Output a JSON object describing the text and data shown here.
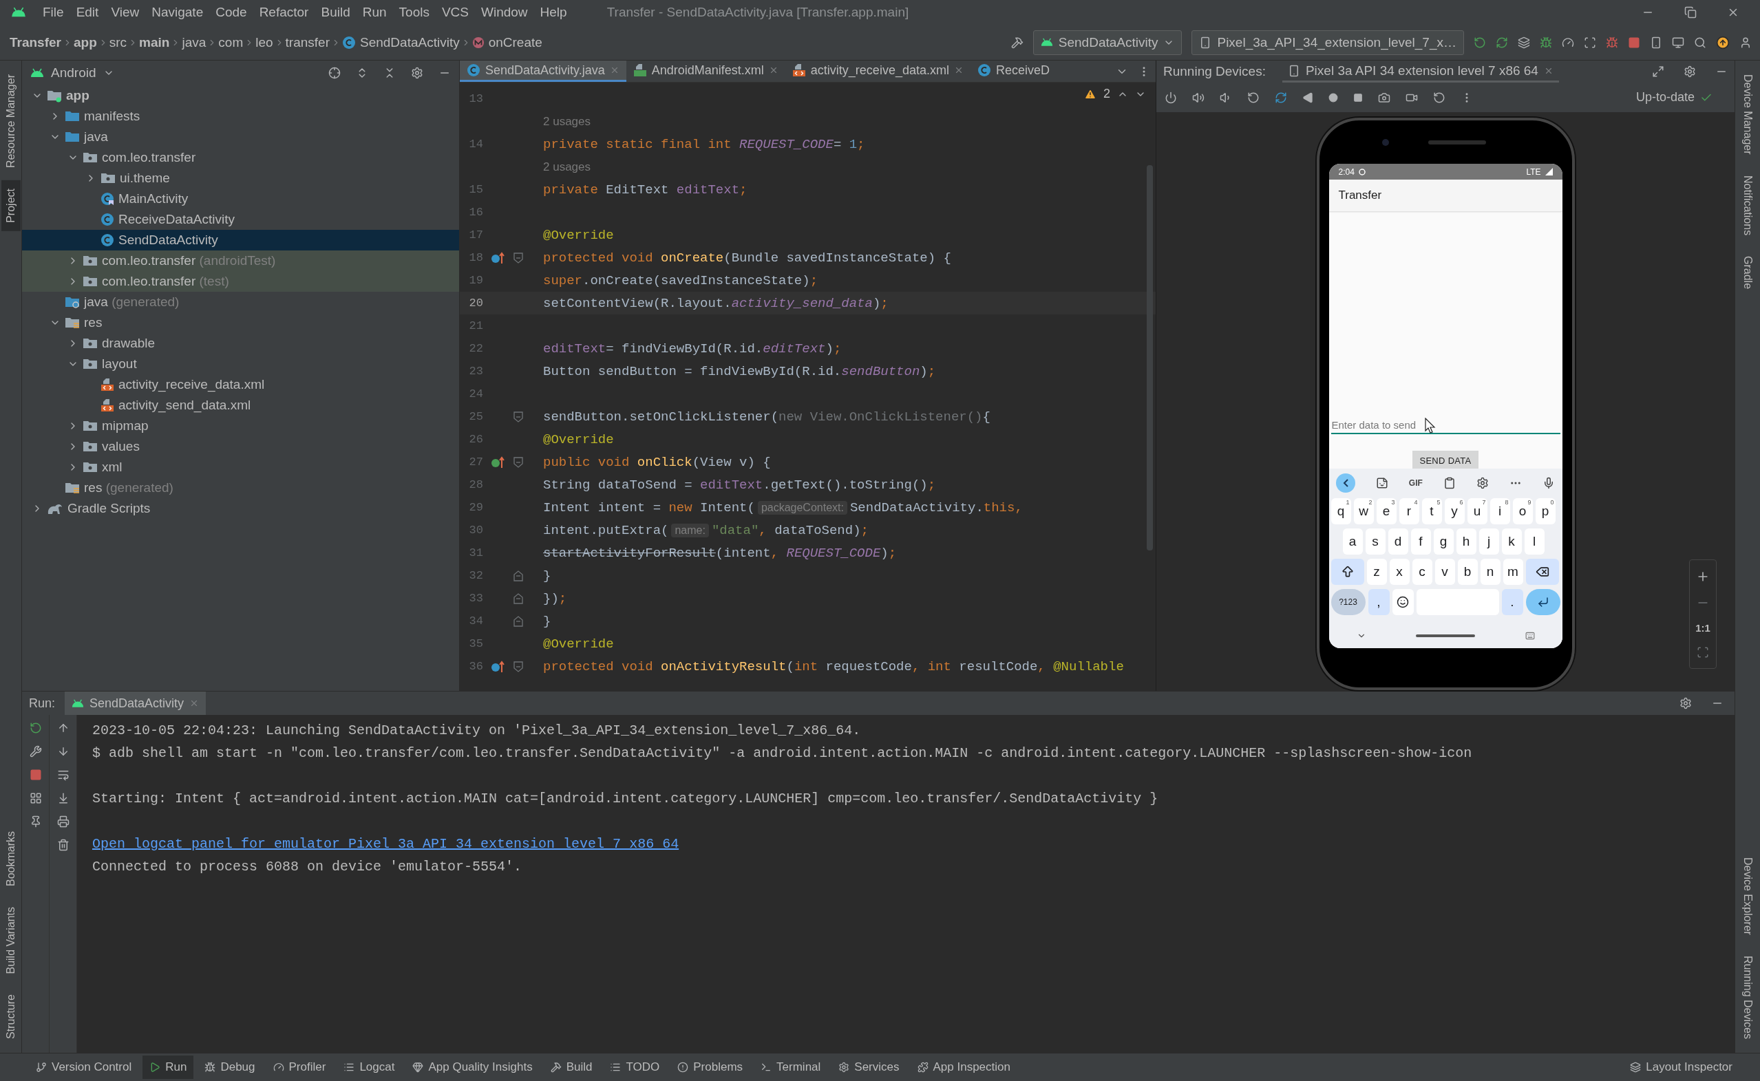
{
  "window": {
    "title": "Transfer - SendDataActivity.java [Transfer.app.main]"
  },
  "menu": [
    "File",
    "Edit",
    "View",
    "Navigate",
    "Code",
    "Refactor",
    "Build",
    "Run",
    "Tools",
    "VCS",
    "Window",
    "Help"
  ],
  "breadcrumbs": [
    {
      "label": "Transfer",
      "kind": "plain",
      "bold": true
    },
    {
      "label": "app",
      "kind": "plain",
      "bold": true
    },
    {
      "label": "src",
      "kind": "plain",
      "bold": false
    },
    {
      "label": "main",
      "kind": "plain",
      "bold": true
    },
    {
      "label": "java",
      "kind": "plain",
      "bold": false
    },
    {
      "label": "com",
      "kind": "plain",
      "bold": false
    },
    {
      "label": "leo",
      "kind": "plain",
      "bold": false
    },
    {
      "label": "transfer",
      "kind": "plain",
      "bold": false
    },
    {
      "label": "SendDataActivity",
      "kind": "class",
      "bold": false
    },
    {
      "label": "onCreate",
      "kind": "method",
      "bold": false
    }
  ],
  "toolbar": {
    "run_config": "SendDataActivity",
    "device": "Pixel_3a_API_34_extension_level_7_x…"
  },
  "left_strip": {
    "top": [
      {
        "label": "Resource Manager",
        "selected": false
      },
      {
        "label": "Project",
        "selected": true
      }
    ],
    "bottom": [
      {
        "label": "Bookmarks",
        "selected": false
      },
      {
        "label": "Build Variants",
        "selected": false
      },
      {
        "label": "Structure",
        "selected": false
      }
    ]
  },
  "right_strip": {
    "top": [
      {
        "label": "Device Manager",
        "selected": false
      },
      {
        "label": "Notifications",
        "selected": false
      },
      {
        "label": "Gradle",
        "selected": false
      }
    ],
    "bottom": [
      {
        "label": "Device Explorer",
        "selected": false
      },
      {
        "label": "Running Devices",
        "selected": false
      }
    ]
  },
  "project": {
    "view": "Android",
    "tree": [
      {
        "label": "app",
        "kind": "module",
        "expanded": true,
        "selected": false,
        "highlighted": false,
        "children": [
          {
            "label": "manifests",
            "kind": "source-folder",
            "expanded": false,
            "selected": false,
            "highlighted": false
          },
          {
            "label": "java",
            "kind": "source-folder",
            "expanded": true,
            "selected": false,
            "highlighted": false,
            "children": [
              {
                "label": "com.leo.transfer",
                "kind": "package",
                "expanded": true,
                "selected": false,
                "highlighted": false,
                "children": [
                  {
                    "label": "ui.theme",
                    "kind": "package",
                    "expanded": false,
                    "selected": false,
                    "highlighted": false
                  },
                  {
                    "label": "MainActivity",
                    "kind": "activity-class",
                    "selected": false,
                    "highlighted": false
                  },
                  {
                    "label": "ReceiveDataActivity",
                    "kind": "class",
                    "selected": false,
                    "highlighted": false
                  },
                  {
                    "label": "SendDataActivity",
                    "kind": "class",
                    "selected": true,
                    "highlighted": false
                  }
                ]
              },
              {
                "label": "com.leo.transfer",
                "suffix": "(androidTest)",
                "kind": "package",
                "expanded": false,
                "selected": false,
                "highlighted": true
              },
              {
                "label": "com.leo.transfer",
                "suffix": "(test)",
                "kind": "package",
                "expanded": false,
                "selected": false,
                "highlighted": true
              }
            ]
          },
          {
            "label": "java",
            "suffix": "(generated)",
            "kind": "generated-folder",
            "selected": false,
            "highlighted": false
          },
          {
            "label": "res",
            "kind": "res-folder",
            "expanded": true,
            "selected": false,
            "highlighted": false,
            "children": [
              {
                "label": "drawable",
                "kind": "package",
                "expanded": false,
                "selected": false,
                "highlighted": false
              },
              {
                "label": "layout",
                "kind": "package",
                "expanded": true,
                "selected": false,
                "highlighted": false,
                "children": [
                  {
                    "label": "activity_receive_data.xml",
                    "kind": "layout-file",
                    "selected": false,
                    "highlighted": false
                  },
                  {
                    "label": "activity_send_data.xml",
                    "kind": "layout-file",
                    "selected": false,
                    "highlighted": false
                  }
                ]
              },
              {
                "label": "mipmap",
                "kind": "package",
                "expanded": false,
                "selected": false,
                "highlighted": false
              },
              {
                "label": "values",
                "kind": "package",
                "expanded": false,
                "selected": false,
                "highlighted": false
              },
              {
                "label": "xml",
                "kind": "package",
                "expanded": false,
                "selected": false,
                "highlighted": false
              }
            ]
          },
          {
            "label": "res",
            "suffix": "(generated)",
            "kind": "res-folder",
            "selected": false,
            "highlighted": false
          }
        ]
      },
      {
        "label": "Gradle Scripts",
        "kind": "gradle",
        "expanded": false,
        "selected": false,
        "highlighted": false
      }
    ]
  },
  "editor": {
    "tabs": [
      {
        "label": "SendDataActivity.java",
        "kind": "class",
        "selected": true,
        "closable": true
      },
      {
        "label": "AndroidManifest.xml",
        "kind": "manifest",
        "selected": false,
        "closable": true
      },
      {
        "label": "activity_receive_data.xml",
        "kind": "layout-file",
        "selected": false,
        "closable": true
      },
      {
        "label": "ReceiveD",
        "kind": "class",
        "selected": false,
        "closable": false
      }
    ],
    "warnings": "2",
    "lines": [
      {
        "kind": "code",
        "number": "13",
        "current": false,
        "overrides": false,
        "implements": false,
        "fold_start": false,
        "fold_end": false
      },
      {
        "kind": "usage",
        "text": "2 usages"
      },
      {
        "kind": "code",
        "number": "14",
        "current": false,
        "overrides": false,
        "implements": false,
        "fold_start": false,
        "fold_end": false,
        "tokens": [
          {
            "kind": "keyword",
            "text": "private static final int "
          },
          {
            "kind": "static",
            "text": "REQUEST_CODE"
          },
          {
            "kind": "plain",
            "text": " = "
          },
          {
            "kind": "number",
            "text": "1"
          },
          {
            "kind": "keyword",
            "text": ";"
          }
        ]
      },
      {
        "kind": "usage",
        "text": "2 usages"
      },
      {
        "kind": "code",
        "number": "15",
        "current": false,
        "overrides": false,
        "implements": false,
        "fold_start": false,
        "fold_end": false,
        "tokens": [
          {
            "kind": "keyword",
            "text": "private "
          },
          {
            "kind": "plain",
            "text": "EditText "
          },
          {
            "kind": "field",
            "text": "editText"
          },
          {
            "kind": "keyword",
            "text": ";"
          }
        ]
      },
      {
        "kind": "code",
        "number": "16",
        "current": false,
        "overrides": false,
        "implements": false,
        "fold_start": false,
        "fold_end": false
      },
      {
        "kind": "code",
        "number": "17",
        "current": false,
        "overrides": false,
        "implements": false,
        "fold_start": false,
        "fold_end": false,
        "tokens": [
          {
            "kind": "annotation",
            "text": "@Override"
          }
        ]
      },
      {
        "kind": "code",
        "number": "18",
        "current": false,
        "overrides": true,
        "implements": false,
        "fold_start": true,
        "fold_end": false,
        "tokens": [
          {
            "kind": "keyword",
            "text": "protected void "
          },
          {
            "kind": "declaration",
            "text": "onCreate"
          },
          {
            "kind": "plain",
            "text": "(Bundle savedInstanceState) {"
          }
        ]
      },
      {
        "kind": "code",
        "number": "19",
        "current": false,
        "overrides": false,
        "implements": false,
        "fold_start": false,
        "fold_end": false,
        "tokens": [
          {
            "kind": "keyword",
            "text": "    super"
          },
          {
            "kind": "plain",
            "text": ".onCreate(savedInstanceState)"
          },
          {
            "kind": "keyword",
            "text": ";"
          }
        ]
      },
      {
        "kind": "code",
        "number": "20",
        "current": true,
        "overrides": false,
        "implements": false,
        "fold_start": false,
        "fold_end": false,
        "tokens": [
          {
            "kind": "plain",
            "text": "    setContentView(R.layout."
          },
          {
            "kind": "static",
            "text": "activity_send_data"
          },
          {
            "kind": "plain",
            "text": ")"
          },
          {
            "kind": "keyword",
            "text": ";"
          }
        ]
      },
      {
        "kind": "code",
        "number": "21",
        "current": false,
        "overrides": false,
        "implements": false,
        "fold_start": false,
        "fold_end": false
      },
      {
        "kind": "code",
        "number": "22",
        "current": false,
        "overrides": false,
        "implements": false,
        "fold_start": false,
        "fold_end": false,
        "tokens": [
          {
            "kind": "field",
            "text": "    editText"
          },
          {
            "kind": "plain",
            "text": " = findViewById(R.id."
          },
          {
            "kind": "static",
            "text": "editText"
          },
          {
            "kind": "plain",
            "text": ")"
          },
          {
            "kind": "keyword",
            "text": ";"
          }
        ]
      },
      {
        "kind": "code",
        "number": "23",
        "current": false,
        "overrides": false,
        "implements": false,
        "fold_start": false,
        "fold_end": false,
        "tokens": [
          {
            "kind": "plain",
            "text": "    Button sendButton = findViewById(R.id."
          },
          {
            "kind": "static",
            "text": "sendButton"
          },
          {
            "kind": "plain",
            "text": ")"
          },
          {
            "kind": "keyword",
            "text": ";"
          }
        ]
      },
      {
        "kind": "code",
        "number": "24",
        "current": false,
        "overrides": false,
        "implements": false,
        "fold_start": false,
        "fold_end": false
      },
      {
        "kind": "code",
        "number": "25",
        "current": false,
        "overrides": false,
        "implements": false,
        "fold_start": true,
        "fold_end": false,
        "tokens": [
          {
            "kind": "plain",
            "text": "    sendButton.setOnClickListener("
          },
          {
            "kind": "dim",
            "text": "new View.OnClickListener()"
          },
          {
            "kind": "plain",
            "text": " {"
          }
        ]
      },
      {
        "kind": "code",
        "number": "26",
        "current": false,
        "overrides": false,
        "implements": false,
        "fold_start": false,
        "fold_end": false,
        "tokens": [
          {
            "kind": "annotation",
            "text": "        @Override"
          }
        ]
      },
      {
        "kind": "code",
        "number": "27",
        "current": false,
        "overrides": false,
        "implements": true,
        "fold_start": true,
        "fold_end": false,
        "tokens": [
          {
            "kind": "keyword",
            "text": "        public void "
          },
          {
            "kind": "declaration",
            "text": "onClick"
          },
          {
            "kind": "plain",
            "text": "(View v) {"
          }
        ]
      },
      {
        "kind": "code",
        "number": "28",
        "current": false,
        "overrides": false,
        "implements": false,
        "fold_start": false,
        "fold_end": false,
        "tokens": [
          {
            "kind": "plain",
            "text": "            String dataToSend = "
          },
          {
            "kind": "field",
            "text": "editText"
          },
          {
            "kind": "plain",
            "text": ".getText().toString()"
          },
          {
            "kind": "keyword",
            "text": ";"
          }
        ]
      },
      {
        "kind": "code",
        "number": "29",
        "current": false,
        "overrides": false,
        "implements": false,
        "fold_start": false,
        "fold_end": false,
        "tokens": [
          {
            "kind": "plain",
            "text": "            Intent intent = "
          },
          {
            "kind": "keyword",
            "text": "new "
          },
          {
            "kind": "plain",
            "text": "Intent("
          },
          {
            "kind": "hint",
            "text": "packageContext:"
          },
          {
            "kind": "plain",
            "text": "SendDataActivity."
          },
          {
            "kind": "keyword",
            "text": "this,"
          }
        ]
      },
      {
        "kind": "code",
        "number": "30",
        "current": false,
        "overrides": false,
        "implements": false,
        "fold_start": false,
        "fold_end": false,
        "tokens": [
          {
            "kind": "plain",
            "text": "            intent.putExtra("
          },
          {
            "kind": "hint",
            "text": "name:"
          },
          {
            "kind": "string",
            "text": "\"data\""
          },
          {
            "kind": "keyword",
            "text": ", "
          },
          {
            "kind": "plain",
            "text": "dataToSend)"
          },
          {
            "kind": "keyword",
            "text": ";"
          }
        ]
      },
      {
        "kind": "code",
        "number": "31",
        "current": false,
        "overrides": false,
        "implements": false,
        "fold_start": false,
        "fold_end": false,
        "tokens": [
          {
            "kind": "deprecated",
            "text": "            startActivityForResult"
          },
          {
            "kind": "plain",
            "text": "(intent"
          },
          {
            "kind": "keyword",
            "text": ", "
          },
          {
            "kind": "static",
            "text": "REQUEST_CODE"
          },
          {
            "kind": "plain",
            "text": ")"
          },
          {
            "kind": "keyword",
            "text": ";"
          }
        ]
      },
      {
        "kind": "code",
        "number": "32",
        "current": false,
        "overrides": false,
        "implements": false,
        "fold_start": false,
        "fold_end": true,
        "tokens": [
          {
            "kind": "plain",
            "text": "        }"
          }
        ]
      },
      {
        "kind": "code",
        "number": "33",
        "current": false,
        "overrides": false,
        "implements": false,
        "fold_start": false,
        "fold_end": true,
        "tokens": [
          {
            "kind": "plain",
            "text": "    })"
          },
          {
            "kind": "keyword",
            "text": ";"
          }
        ]
      },
      {
        "kind": "code",
        "number": "34",
        "current": false,
        "overrides": false,
        "implements": false,
        "fold_start": false,
        "fold_end": true,
        "tokens": [
          {
            "kind": "plain",
            "text": "}"
          }
        ]
      },
      {
        "kind": "code",
        "number": "35",
        "current": false,
        "overrides": false,
        "implements": false,
        "fold_start": false,
        "fold_end": false,
        "tokens": [
          {
            "kind": "annotation",
            "text": "@Override"
          }
        ]
      },
      {
        "kind": "code",
        "number": "36",
        "current": false,
        "overrides": true,
        "implements": false,
        "fold_start": true,
        "fold_end": false,
        "tokens": [
          {
            "kind": "keyword",
            "text": "protected void "
          },
          {
            "kind": "declaration",
            "text": "onActivityResult"
          },
          {
            "kind": "plain",
            "text": "("
          },
          {
            "kind": "keyword",
            "text": "int "
          },
          {
            "kind": "plain",
            "text": "requestCode"
          },
          {
            "kind": "keyword",
            "text": ", int "
          },
          {
            "kind": "plain",
            "text": "resultCode"
          },
          {
            "kind": "keyword",
            "text": ", "
          },
          {
            "kind": "annotation",
            "text": "@Nullable"
          }
        ]
      }
    ]
  },
  "devices": {
    "label": "Running Devices:",
    "tab": "Pixel 3a API 34 extension level 7 x86 64",
    "status": "Up-to-date",
    "phone": {
      "time": "2:04",
      "network": "LTE",
      "app_title": "Transfer",
      "placeholder": "Enter data to send",
      "button": "SEND DATA",
      "keyboard_toolbar": [
        {
          "kind": "back"
        },
        {
          "kind": "sticker"
        },
        {
          "kind": "text",
          "label": "GIF"
        },
        {
          "kind": "clipboard"
        },
        {
          "kind": "settings"
        },
        {
          "kind": "more"
        },
        {
          "kind": "mic"
        }
      ],
      "keyboard_rows": [
        {
          "keys": [
            {
              "kind": "letter",
              "label": "q",
              "hint": "1"
            },
            {
              "kind": "letter",
              "label": "w",
              "hint": "2"
            },
            {
              "kind": "letter",
              "label": "e",
              "hint": "3"
            },
            {
              "kind": "letter",
              "label": "r",
              "hint": "4"
            },
            {
              "kind": "letter",
              "label": "t",
              "hint": "5"
            },
            {
              "kind": "letter",
              "label": "y",
              "hint": "6"
            },
            {
              "kind": "letter",
              "label": "u",
              "hint": "7"
            },
            {
              "kind": "letter",
              "label": "i",
              "hint": "8"
            },
            {
              "kind": "letter",
              "label": "o",
              "hint": "9"
            },
            {
              "kind": "letter",
              "label": "p",
              "hint": "0"
            }
          ]
        },
        {
          "keys": [
            {
              "kind": "letter",
              "label": "a"
            },
            {
              "kind": "letter",
              "label": "s"
            },
            {
              "kind": "letter",
              "label": "d"
            },
            {
              "kind": "letter",
              "label": "f"
            },
            {
              "kind": "letter",
              "label": "g"
            },
            {
              "kind": "letter",
              "label": "h"
            },
            {
              "kind": "letter",
              "label": "j"
            },
            {
              "kind": "letter",
              "label": "k"
            },
            {
              "kind": "letter",
              "label": "l"
            }
          ]
        },
        {
          "keys": [
            {
              "kind": "shift"
            },
            {
              "kind": "letter",
              "label": "z"
            },
            {
              "kind": "letter",
              "label": "x"
            },
            {
              "kind": "letter",
              "label": "c"
            },
            {
              "kind": "letter",
              "label": "v"
            },
            {
              "kind": "letter",
              "label": "b"
            },
            {
              "kind": "letter",
              "label": "n"
            },
            {
              "kind": "letter",
              "label": "m"
            },
            {
              "kind": "backspace"
            }
          ]
        },
        {
          "keys": [
            {
              "kind": "symbols",
              "label": "?123"
            },
            {
              "kind": "punct",
              "label": ","
            },
            {
              "kind": "emoji"
            },
            {
              "kind": "space"
            },
            {
              "kind": "punct",
              "label": "."
            },
            {
              "kind": "enter"
            }
          ]
        }
      ]
    },
    "zoom": "1:1"
  },
  "run": {
    "label": "Run:",
    "tab": "SendDataActivity",
    "console": [
      {
        "kind": "text",
        "text": "2023-10-05 22:04:23: Launching SendDataActivity on 'Pixel_3a_API_34_extension_level_7_x86_64."
      },
      {
        "kind": "text",
        "text": "$ adb shell am start -n \"com.leo.transfer/com.leo.transfer.SendDataActivity\" -a android.intent.action.MAIN -c android.intent.category.LAUNCHER --splashscreen-show-icon"
      },
      {
        "kind": "blank"
      },
      {
        "kind": "text",
        "text": "Starting: Intent { act=android.intent.action.MAIN cat=[android.intent.category.LAUNCHER] cmp=com.leo.transfer/.SendDataActivity }"
      },
      {
        "kind": "blank"
      },
      {
        "kind": "link",
        "text": "Open logcat panel for emulator Pixel 3a API 34 extension level 7 x86 64"
      },
      {
        "kind": "text",
        "text": "Connected to process 6088 on device 'emulator-5554'."
      }
    ]
  },
  "bottom_bar": {
    "items": [
      {
        "kind": "vcs",
        "label": "Version Control",
        "selected": false
      },
      {
        "kind": "run",
        "label": "Run",
        "selected": true
      },
      {
        "kind": "debug",
        "label": "Debug",
        "selected": false
      },
      {
        "kind": "profiler",
        "label": "Profiler",
        "selected": false
      },
      {
        "kind": "logcat",
        "label": "Logcat",
        "selected": false
      },
      {
        "kind": "quality",
        "label": "App Quality Insights",
        "selected": false
      },
      {
        "kind": "build",
        "label": "Build",
        "selected": false
      },
      {
        "kind": "todo",
        "label": "TODO",
        "selected": false
      },
      {
        "kind": "problems",
        "label": "Problems",
        "selected": false
      },
      {
        "kind": "terminal",
        "label": "Terminal",
        "selected": false
      },
      {
        "kind": "services",
        "label": "Services",
        "selected": false
      },
      {
        "kind": "inspection",
        "label": "App Inspection",
        "selected": false
      }
    ],
    "right": "Layout Inspector"
  }
}
